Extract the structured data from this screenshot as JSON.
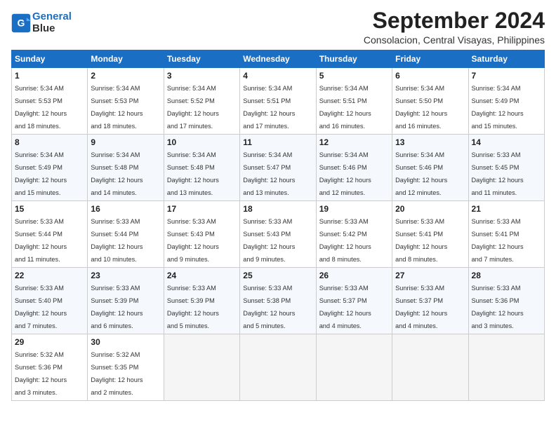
{
  "header": {
    "logo_line1": "General",
    "logo_line2": "Blue",
    "month": "September 2024",
    "location": "Consolacion, Central Visayas, Philippines"
  },
  "weekdays": [
    "Sunday",
    "Monday",
    "Tuesday",
    "Wednesday",
    "Thursday",
    "Friday",
    "Saturday"
  ],
  "weeks": [
    [
      {
        "day": "1",
        "sunrise": "5:34 AM",
        "sunset": "5:53 PM",
        "hours": "12",
        "minutes": "18"
      },
      {
        "day": "2",
        "sunrise": "5:34 AM",
        "sunset": "5:53 PM",
        "hours": "12",
        "minutes": "18"
      },
      {
        "day": "3",
        "sunrise": "5:34 AM",
        "sunset": "5:52 PM",
        "hours": "12",
        "minutes": "17"
      },
      {
        "day": "4",
        "sunrise": "5:34 AM",
        "sunset": "5:51 PM",
        "hours": "12",
        "minutes": "17"
      },
      {
        "day": "5",
        "sunrise": "5:34 AM",
        "sunset": "5:51 PM",
        "hours": "12",
        "minutes": "16"
      },
      {
        "day": "6",
        "sunrise": "5:34 AM",
        "sunset": "5:50 PM",
        "hours": "12",
        "minutes": "16"
      },
      {
        "day": "7",
        "sunrise": "5:34 AM",
        "sunset": "5:49 PM",
        "hours": "12",
        "minutes": "15"
      }
    ],
    [
      {
        "day": "8",
        "sunrise": "5:34 AM",
        "sunset": "5:49 PM",
        "hours": "12",
        "minutes": "15"
      },
      {
        "day": "9",
        "sunrise": "5:34 AM",
        "sunset": "5:48 PM",
        "hours": "12",
        "minutes": "14"
      },
      {
        "day": "10",
        "sunrise": "5:34 AM",
        "sunset": "5:48 PM",
        "hours": "12",
        "minutes": "13"
      },
      {
        "day": "11",
        "sunrise": "5:34 AM",
        "sunset": "5:47 PM",
        "hours": "12",
        "minutes": "13"
      },
      {
        "day": "12",
        "sunrise": "5:34 AM",
        "sunset": "5:46 PM",
        "hours": "12",
        "minutes": "12"
      },
      {
        "day": "13",
        "sunrise": "5:34 AM",
        "sunset": "5:46 PM",
        "hours": "12",
        "minutes": "12"
      },
      {
        "day": "14",
        "sunrise": "5:33 AM",
        "sunset": "5:45 PM",
        "hours": "12",
        "minutes": "11"
      }
    ],
    [
      {
        "day": "15",
        "sunrise": "5:33 AM",
        "sunset": "5:44 PM",
        "hours": "12",
        "minutes": "11"
      },
      {
        "day": "16",
        "sunrise": "5:33 AM",
        "sunset": "5:44 PM",
        "hours": "12",
        "minutes": "10"
      },
      {
        "day": "17",
        "sunrise": "5:33 AM",
        "sunset": "5:43 PM",
        "hours": "12",
        "minutes": "9"
      },
      {
        "day": "18",
        "sunrise": "5:33 AM",
        "sunset": "5:43 PM",
        "hours": "12",
        "minutes": "9"
      },
      {
        "day": "19",
        "sunrise": "5:33 AM",
        "sunset": "5:42 PM",
        "hours": "12",
        "minutes": "8"
      },
      {
        "day": "20",
        "sunrise": "5:33 AM",
        "sunset": "5:41 PM",
        "hours": "12",
        "minutes": "8"
      },
      {
        "day": "21",
        "sunrise": "5:33 AM",
        "sunset": "5:41 PM",
        "hours": "12",
        "minutes": "7"
      }
    ],
    [
      {
        "day": "22",
        "sunrise": "5:33 AM",
        "sunset": "5:40 PM",
        "hours": "12",
        "minutes": "7"
      },
      {
        "day": "23",
        "sunrise": "5:33 AM",
        "sunset": "5:39 PM",
        "hours": "12",
        "minutes": "6"
      },
      {
        "day": "24",
        "sunrise": "5:33 AM",
        "sunset": "5:39 PM",
        "hours": "12",
        "minutes": "5"
      },
      {
        "day": "25",
        "sunrise": "5:33 AM",
        "sunset": "5:38 PM",
        "hours": "12",
        "minutes": "5"
      },
      {
        "day": "26",
        "sunrise": "5:33 AM",
        "sunset": "5:37 PM",
        "hours": "12",
        "minutes": "4"
      },
      {
        "day": "27",
        "sunrise": "5:33 AM",
        "sunset": "5:37 PM",
        "hours": "12",
        "minutes": "4"
      },
      {
        "day": "28",
        "sunrise": "5:33 AM",
        "sunset": "5:36 PM",
        "hours": "12",
        "minutes": "3"
      }
    ],
    [
      {
        "day": "29",
        "sunrise": "5:32 AM",
        "sunset": "5:36 PM",
        "hours": "12",
        "minutes": "3"
      },
      {
        "day": "30",
        "sunrise": "5:32 AM",
        "sunset": "5:35 PM",
        "hours": "12",
        "minutes": "2"
      },
      null,
      null,
      null,
      null,
      null
    ]
  ]
}
